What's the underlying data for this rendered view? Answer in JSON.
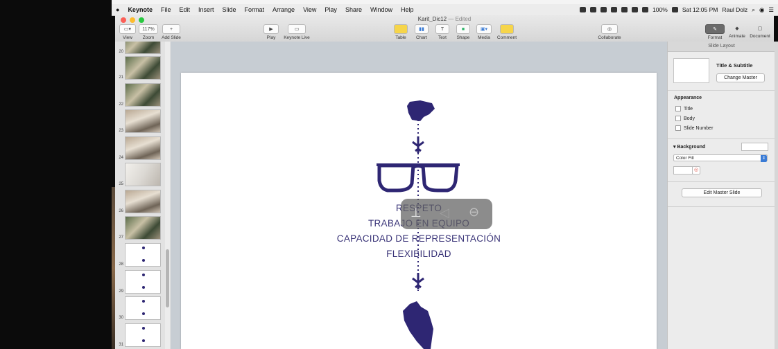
{
  "menubar": {
    "apple": "",
    "app": "Keynote",
    "items": [
      "File",
      "Edit",
      "Insert",
      "Slide",
      "Format",
      "Arrange",
      "View",
      "Play",
      "Share",
      "Window",
      "Help"
    ],
    "battery": "100%",
    "datetime": "Sat 12:05 PM",
    "user": "Raul Dolz"
  },
  "window": {
    "title": "Karit_Dic12",
    "edited": "— Edited"
  },
  "toolbar": {
    "view": "View",
    "zoom_value": "117%",
    "zoom": "Zoom",
    "add_slide": "Add Slide",
    "play": "Play",
    "keynote_live": "Keynote Live",
    "table": "Table",
    "chart": "Chart",
    "text": "Text",
    "shape": "Shape",
    "media": "Media",
    "comment": "Comment",
    "collaborate": "Collaborate",
    "format": "Format",
    "animate": "Animate",
    "document": "Document"
  },
  "slides": [
    {
      "num": "20",
      "kind": "photo"
    },
    {
      "num": "21",
      "kind": "photo"
    },
    {
      "num": "22",
      "kind": "photo"
    },
    {
      "num": "23",
      "kind": "photo2"
    },
    {
      "num": "24",
      "kind": "photo2"
    },
    {
      "num": "25",
      "kind": "photo3"
    },
    {
      "num": "26",
      "kind": "photo2"
    },
    {
      "num": "27",
      "kind": "photo"
    },
    {
      "num": "28",
      "kind": "slide"
    },
    {
      "num": "29",
      "kind": "slide"
    },
    {
      "num": "30",
      "kind": "slide"
    },
    {
      "num": "31",
      "kind": "slide"
    }
  ],
  "slide": {
    "lines": [
      "RESPETO",
      "TRABAJO EN EQUIPO",
      "CAPACIDAD DE REPRESENTACIÓN",
      "FLEXIBILIDAD"
    ],
    "color": "#2e2673"
  },
  "inspector": {
    "header": "Slide Layout",
    "layout_name": "Title & Subtitle",
    "change_master": "Change Master",
    "appearance": "Appearance",
    "title": "Title",
    "body": "Body",
    "slide_number": "Slide Number",
    "background": "Background",
    "fill": "Color Fill",
    "edit_master": "Edit Master Slide"
  }
}
